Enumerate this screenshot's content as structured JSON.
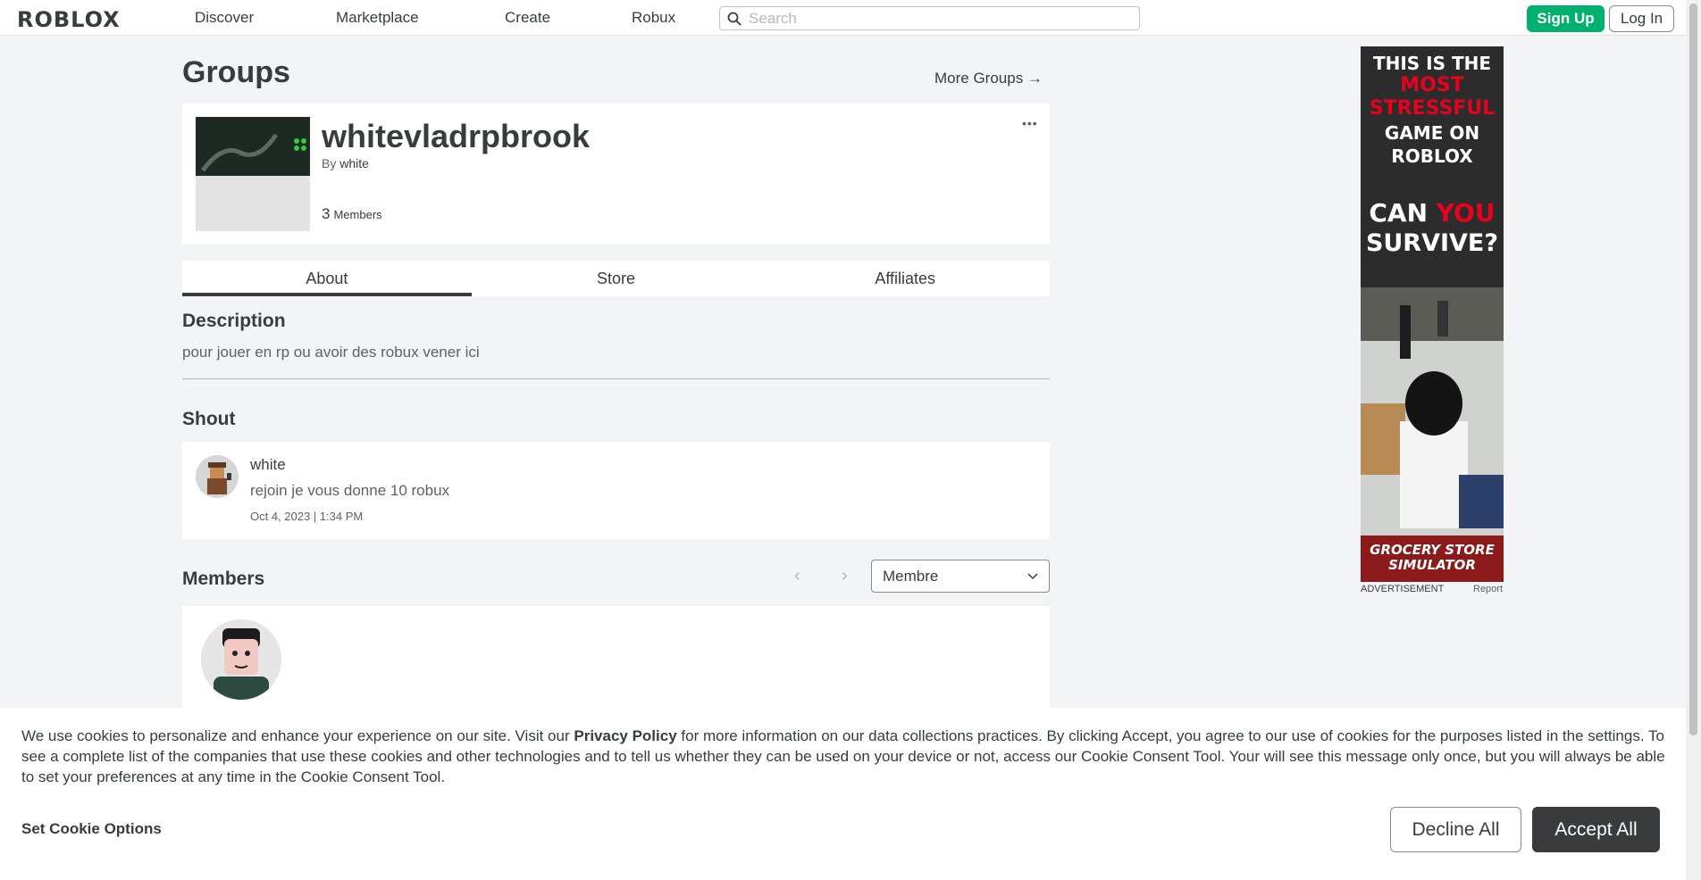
{
  "header": {
    "logo": "ROBLOX",
    "nav": [
      "Discover",
      "Marketplace",
      "Create",
      "Robux"
    ],
    "search_placeholder": "Search",
    "signup_label": "Sign Up",
    "login_label": "Log In"
  },
  "page": {
    "title": "Groups",
    "more_groups": "More Groups →"
  },
  "group": {
    "name": "whitevladrpbrook",
    "by_label": "By",
    "owner": "white",
    "member_count": "3",
    "members_label": "Members",
    "more_menu": "•••"
  },
  "tabs": [
    "About",
    "Store",
    "Affiliates"
  ],
  "active_tab": "About",
  "about": {
    "description_title": "Description",
    "description": "pour jouer en rp ou avoir des robux vener ici",
    "shout_title": "Shout",
    "shout": {
      "user": "white",
      "text": "rejoin je vous donne 10 robux",
      "date": "Oct 4, 2023 | 1:34 PM"
    },
    "members_title": "Members",
    "role_select": "Membre",
    "pager_prev": "‹",
    "pager_next": "›"
  },
  "ad": {
    "line1": "THIS IS THE",
    "line2": "MOST",
    "line3": "STRESSFUL",
    "line4": "GAME ON",
    "line5": "ROBLOX",
    "line6a": "CAN",
    "line6b": "YOU",
    "line7": "SURVIVE?",
    "logo": "GROCERY STORE SIMULATOR",
    "label": "ADVERTISEMENT",
    "report": "Report"
  },
  "cookie": {
    "text_pre": "We use cookies to personalize and enhance your experience on our site. Visit our ",
    "policy_link": "Privacy Policy",
    "text_post": " for more information on our data collections practices. By clicking Accept, you agree to our use of cookies for the purposes listed in the settings. To see a complete list of the companies that use these cookies and other technologies and to tell us whether they can be used on your device or not, access our Cookie Consent Tool. Your will see this message only once, but you will always be able to set your preferences at any time in the Cookie Consent Tool.",
    "options_label": "Set Cookie Options",
    "decline_label": "Decline All",
    "accept_label": "Accept All"
  },
  "colors": {
    "signup_green": "#00b06f",
    "ad_red": "#e8001c",
    "accept_dark": "#393b3d"
  }
}
